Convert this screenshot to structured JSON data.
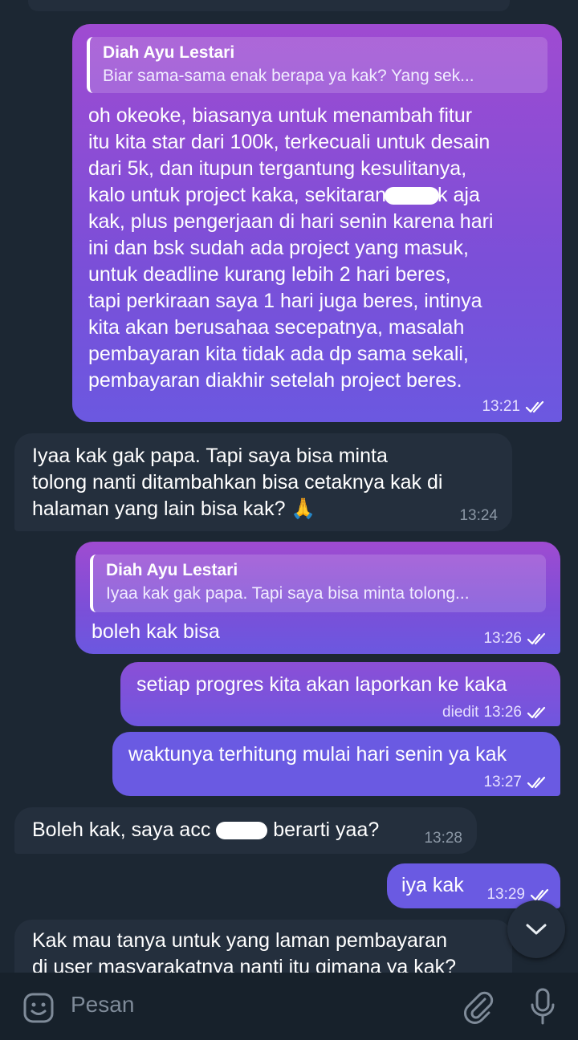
{
  "messages": [
    {
      "reply_name": "Diah Ayu Lestari",
      "reply_text": "Biar sama-sama enak berapa ya kak? Yang sek...",
      "text": "oh okeoke, biasanya untuk menambah fitur\nitu kita star dari 100k, terkecuali untuk desain\ndari 5k, dan itupun tergantung kesulitanya,\nkalo untuk project kaka, sekitaran",
      "text_after_redact": "k aja\nkak, plus pengerjaan di hari senin karena hari\nini dan bsk sudah ada project yang masuk,\nuntuk deadline kurang lebih 2 hari beres,\ntapi perkiraan saya 1 hari juga beres, intinya\nkita akan berusahaa secepatnya, masalah\npembayaran kita tidak ada dp sama sekali,\npembayaran diakhir setelah project beres.",
      "time": "13:21"
    },
    {
      "text": "Iyaa kak gak papa. Tapi saya bisa minta\ntolong nanti ditambahkan bisa cetaknya kak di\nhalaman yang lain bisa kak? 🙏",
      "time": "13:24"
    },
    {
      "reply_name": "Diah Ayu Lestari",
      "reply_text": "Iyaa kak gak papa. Tapi saya bisa minta tolong...",
      "text": "boleh kak bisa",
      "time": "13:26"
    },
    {
      "text": "setiap progres kita akan laporkan ke kaka",
      "edited": "diedit",
      "time": "13:26"
    },
    {
      "text": "waktunya terhitung mulai hari senin ya kak",
      "time": "13:27"
    },
    {
      "text_before": "Boleh kak, saya acc",
      "text_after": "berarti yaa?",
      "time": "13:28"
    },
    {
      "text": "iya kak",
      "time": "13:29"
    },
    {
      "text": "Kak mau tanya untuk yang laman pembayaran\ndi user masyarakatnya nanti itu gimana ya kak?"
    }
  ],
  "input": {
    "placeholder": "Pesan"
  },
  "icons": {
    "emoji": "emoji-sticker-icon",
    "attach": "paperclip-icon",
    "mic": "microphone-icon",
    "scroll": "chevron-down-icon",
    "read": "double-check-icon"
  },
  "colors": {
    "background": "#1c2733",
    "incoming": "#242f3d",
    "outgoing_start": "#9f4bd1",
    "outgoing_end": "#6a5ae2"
  }
}
